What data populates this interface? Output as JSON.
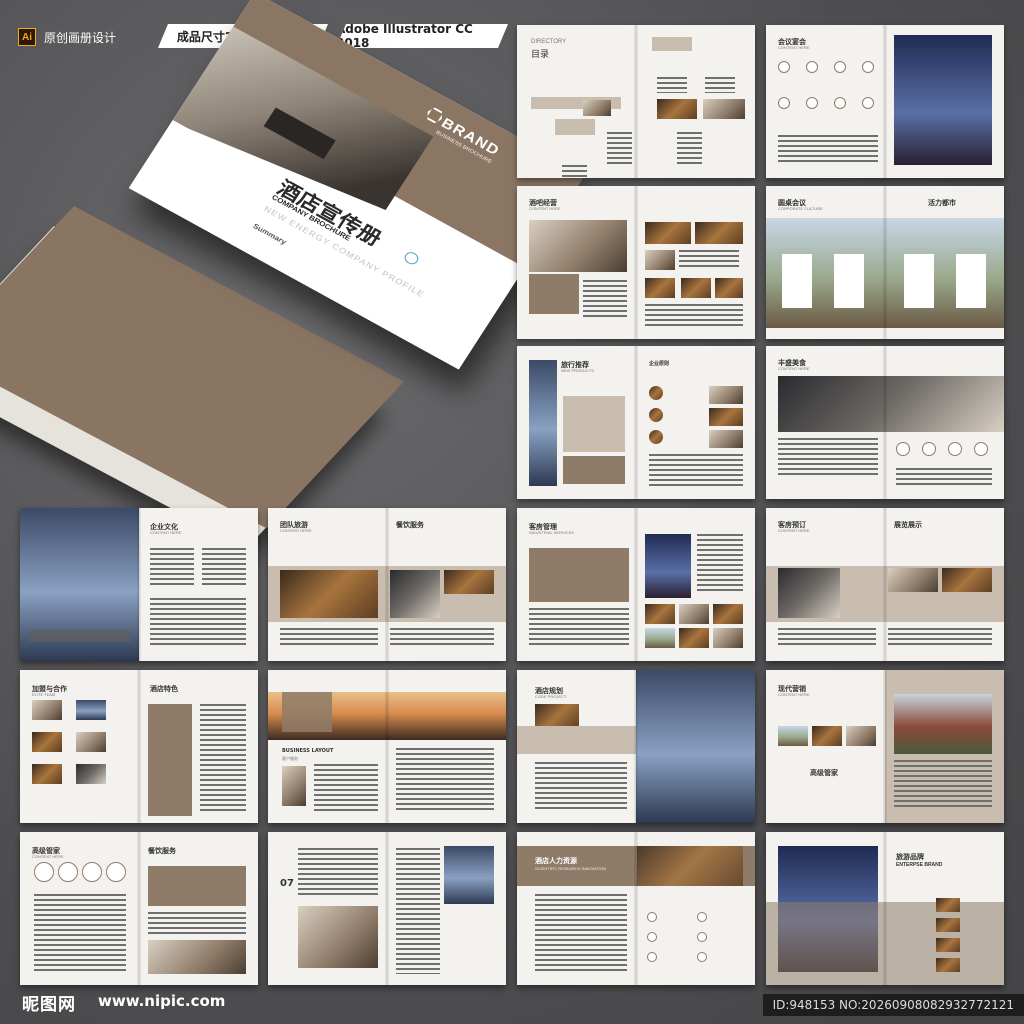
{
  "topbar": {
    "ai_icon": "Ai",
    "label": "原创画册设计",
    "size": "成品尺寸210X285mm",
    "software": "Adobe Illustrator CC 2018"
  },
  "cover": {
    "brand": "BRAND",
    "brand_sub": "BUSINESS BROCHURE",
    "title": "酒店宣传册",
    "subtitle": "COMPANY BROCHURE",
    "subtitle2": "NEW ENERGY COMPANY PROFILE",
    "summary": "Summary"
  },
  "spreads": [
    {
      "title": "DIRECTORY",
      "sub": "目录"
    },
    {
      "title": "会议宴会",
      "sub": "CONTENT HERE"
    },
    {
      "title": "酒吧经营",
      "sub": "CONTENT HERE"
    },
    {
      "title": "圆桌会议",
      "sub": "CORPORATE CULTURE",
      "title2": "活力都市"
    },
    {
      "title": "旅行推荐",
      "sub": "NEW PRODUCTS",
      "title2": "企业原则"
    },
    {
      "title": "丰盛美食",
      "sub": "CONTENT HERE"
    },
    {
      "title": "企业文化",
      "sub": "CONTENT HERE"
    },
    {
      "title": "团队旅游",
      "sub": "CONTENT HERE",
      "title2": "餐饮服务"
    },
    {
      "title": "客房管理",
      "sub": "INDUSTRIAL SERVICES"
    },
    {
      "title": "客房预订",
      "sub": "CONTENT HERE",
      "title2": "展览展示"
    },
    {
      "title": "加盟与合作",
      "sub": "ELITE TEAM",
      "title2": "酒店特色"
    },
    {
      "title": "BUSINESS LAYOUT",
      "sub": "客户服务"
    },
    {
      "title": "酒店规划",
      "sub": "CODE PROJECT"
    },
    {
      "title": "现代营销",
      "sub": "CONTENT HERE",
      "title2": "高级管家"
    },
    {
      "title": "高级管家",
      "sub": "CONTENT HERE",
      "title2": "餐饮服务"
    },
    {
      "title": "07",
      "sub": ""
    },
    {
      "title": "酒店人力资源",
      "sub": "SCIENTIFIC RESEARCH INNOVATION"
    },
    {
      "title": "旅游品牌",
      "sub": "ENTERPSE BRAND"
    }
  ],
  "footer": {
    "site": "昵图网",
    "url": "www.nipic.com",
    "id": "ID:948153 NO:20260908082932772121"
  }
}
